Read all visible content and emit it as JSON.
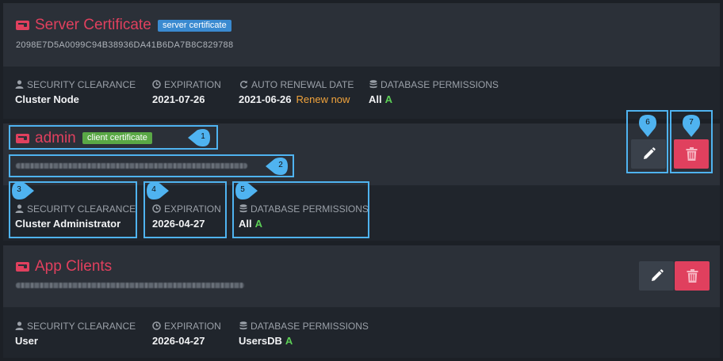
{
  "certificates": [
    {
      "title": "Server Certificate",
      "badge": "server certificate",
      "thumbprint": "2098E7D5A0099C94B38936DA41B6DA7B8C829788",
      "security_label": "SECURITY CLEARANCE",
      "security_value": "Cluster Node",
      "expiration_label": "EXPIRATION",
      "expiration_value": "2021-07-26",
      "renewal_label": "AUTO RENEWAL DATE",
      "renewal_value": "2021-06-26",
      "renew_link": "Renew now",
      "db_label": "DATABASE PERMISSIONS",
      "db_value": "All",
      "db_access": "A"
    },
    {
      "title": "admin",
      "badge": "client certificate",
      "security_label": "SECURITY CLEARANCE",
      "security_value": "Cluster Administrator",
      "expiration_label": "EXPIRATION",
      "expiration_value": "2026-04-27",
      "db_label": "DATABASE PERMISSIONS",
      "db_value": "All",
      "db_access": "A"
    },
    {
      "title": "App Clients",
      "security_label": "SECURITY CLEARANCE",
      "security_value": "User",
      "expiration_label": "EXPIRATION",
      "expiration_value": "2026-04-27",
      "db_label": "DATABASE PERMISSIONS",
      "db_value": "UsersDB",
      "db_access": "A"
    }
  ],
  "callouts": [
    "1",
    "2",
    "3",
    "4",
    "5",
    "6",
    "7"
  ],
  "colors": {
    "accent_red": "#e0405e",
    "server_badge": "#3a8ad0",
    "client_badge": "#5aa846",
    "highlight": "#4fb3f0",
    "renew_orange": "#f0a33c",
    "access_green": "#5ccf56"
  },
  "icons": {
    "certificate": "certificate-icon",
    "user": "user-icon",
    "clock": "clock-icon",
    "refresh": "refresh-icon",
    "database": "database-icon",
    "edit": "pencil-icon",
    "delete": "trash-icon"
  }
}
